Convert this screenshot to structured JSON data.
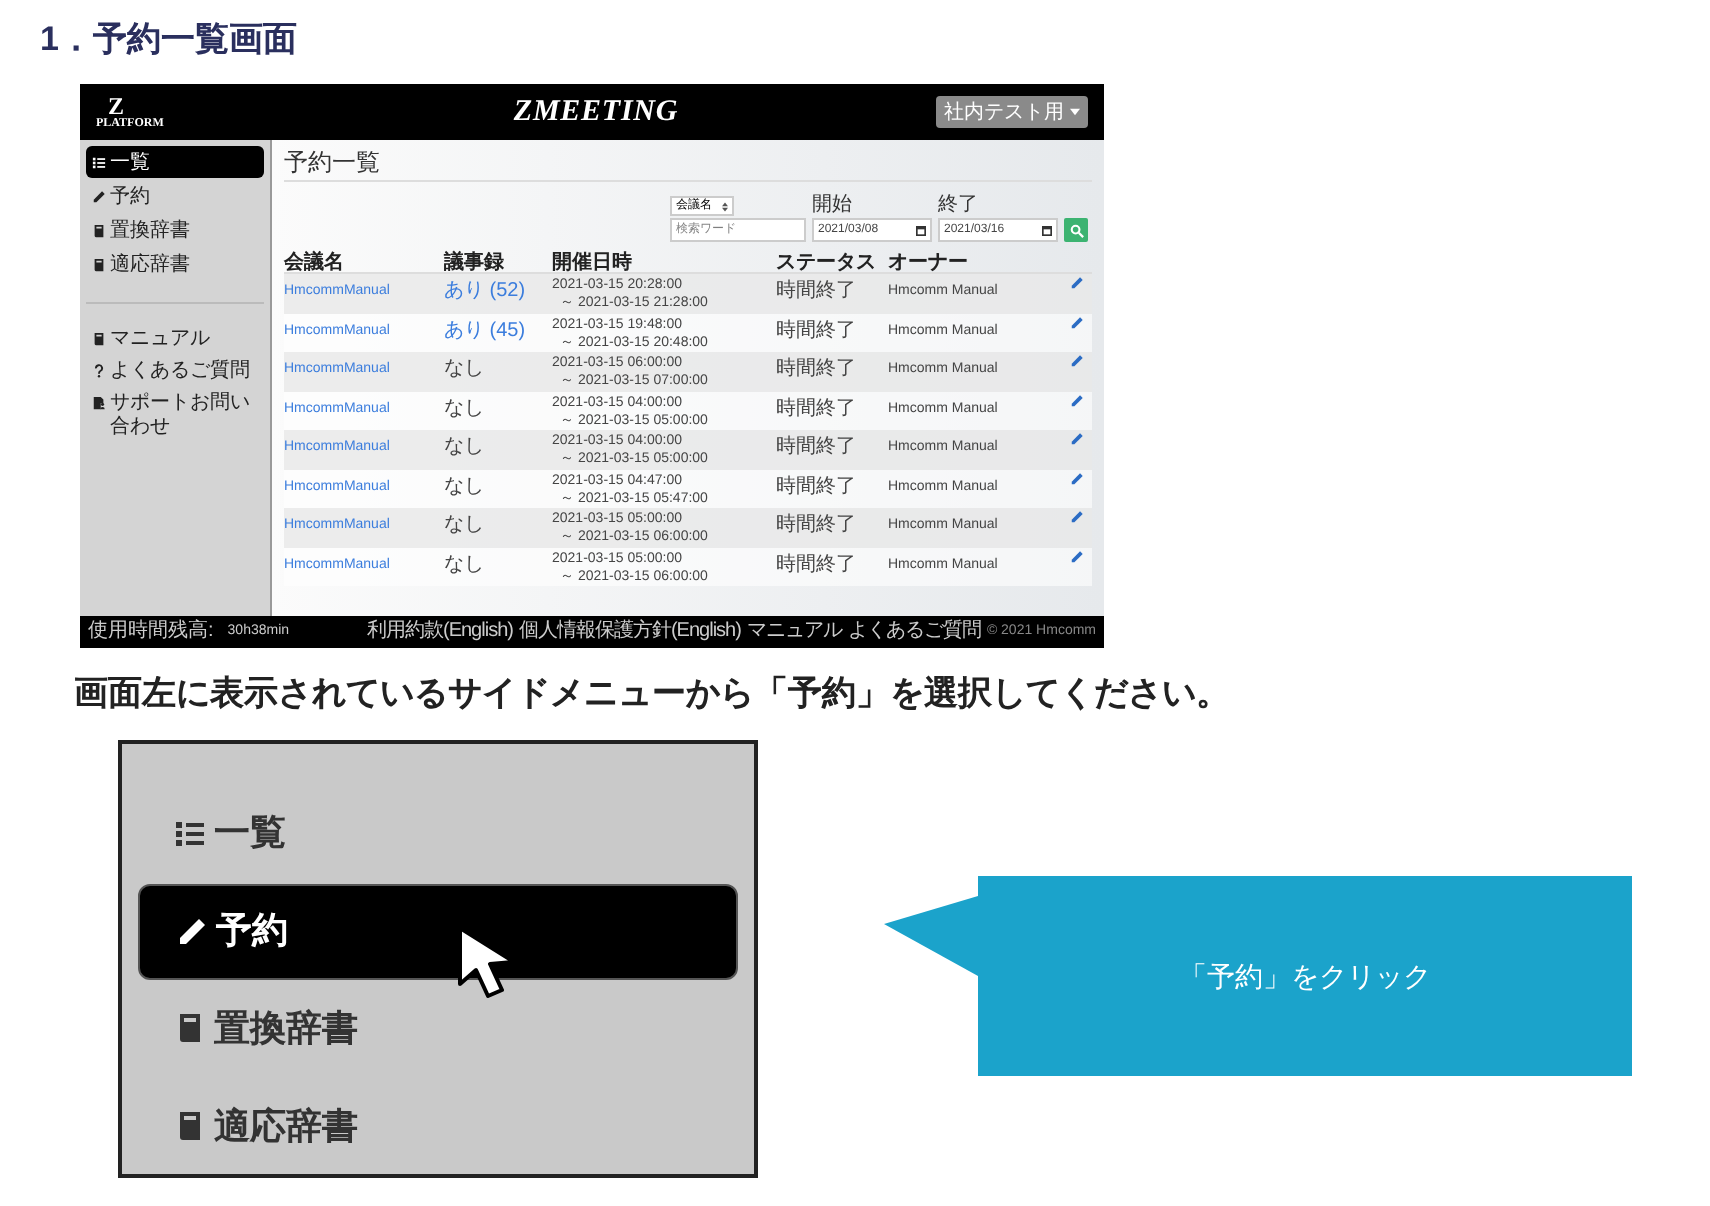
{
  "heading": "1．予約一覧画面",
  "screenshot": {
    "logo": {
      "letter": "Z",
      "text": "PLATFORM"
    },
    "app_title": "ZMEETING",
    "user_menu": "社内テスト用",
    "sidebar": {
      "items": [
        {
          "label": "一覧",
          "kind": "list",
          "selected": true
        },
        {
          "label": "予約",
          "kind": "pencil",
          "selected": false
        },
        {
          "label": "置換辞書",
          "kind": "book",
          "selected": false
        },
        {
          "label": "適応辞書",
          "kind": "book",
          "selected": false
        }
      ],
      "bottom_items": [
        {
          "label": "マニュアル",
          "kind": "book"
        },
        {
          "label": "よくあるご質問",
          "kind": "question"
        },
        {
          "label": "サポートお問い合わせ",
          "kind": "support"
        }
      ]
    },
    "page_title": "予約一覧",
    "search": {
      "field_select": "会議名",
      "keyword_placeholder": "検索ワード",
      "start_label": "開始",
      "start_date": "2021/03/08",
      "end_label": "終了",
      "end_date": "2021/03/16"
    },
    "table": {
      "columns": [
        "会議名",
        "議事録",
        "開催日時",
        "ステータス",
        "オーナー"
      ],
      "rows": [
        {
          "name": "HmcommManual",
          "minutes": "あり (52)",
          "kind": "link",
          "start": "2021-03-15 20:28:00",
          "end": "～ 2021-03-15 21:28:00",
          "status": "時間終了",
          "owner": "Hmcomm Manual"
        },
        {
          "name": "HmcommManual",
          "minutes": "あり (45)",
          "kind": "link",
          "start": "2021-03-15 19:48:00",
          "end": "～ 2021-03-15 20:48:00",
          "status": "時間終了",
          "owner": "Hmcomm Manual"
        },
        {
          "name": "HmcommManual",
          "minutes": "なし",
          "kind": "plain",
          "start": "2021-03-15 06:00:00",
          "end": "～ 2021-03-15 07:00:00",
          "status": "時間終了",
          "owner": "Hmcomm Manual"
        },
        {
          "name": "HmcommManual",
          "minutes": "なし",
          "kind": "plain",
          "start": "2021-03-15 04:00:00",
          "end": "～ 2021-03-15 05:00:00",
          "status": "時間終了",
          "owner": "Hmcomm Manual"
        },
        {
          "name": "HmcommManual",
          "minutes": "なし",
          "kind": "plain",
          "start": "2021-03-15 04:00:00",
          "end": "～ 2021-03-15 05:00:00",
          "status": "時間終了",
          "owner": "Hmcomm Manual"
        },
        {
          "name": "HmcommManual",
          "minutes": "なし",
          "kind": "plain",
          "start": "2021-03-15 04:47:00",
          "end": "～ 2021-03-15 05:47:00",
          "status": "時間終了",
          "owner": "Hmcomm Manual"
        },
        {
          "name": "HmcommManual",
          "minutes": "なし",
          "kind": "plain",
          "start": "2021-03-15 05:00:00",
          "end": "～ 2021-03-15 06:00:00",
          "status": "時間終了",
          "owner": "Hmcomm Manual"
        },
        {
          "name": "HmcommManual",
          "minutes": "なし",
          "kind": "plain",
          "start": "2021-03-15 05:00:00",
          "end": "～ 2021-03-15 06:00:00",
          "status": "時間終了",
          "owner": "Hmcomm Manual"
        }
      ]
    },
    "footer": {
      "remaining_label": "使用時間残高:",
      "remaining": "30h38min",
      "links": [
        "利用約款(English)",
        "個人情報保護方針(English)",
        "マニュアル",
        "よくあるご質問"
      ],
      "copyright": "© 2021 Hmcomm"
    }
  },
  "instruction": "画面左に表示されているサイドメニューから「予約」を選択してください。",
  "zoomed_sidebar": {
    "items": [
      {
        "label": "一覧",
        "kind": "list",
        "selected": false
      },
      {
        "label": "予約",
        "kind": "pencil",
        "selected": true
      },
      {
        "label": "置換辞書",
        "kind": "book",
        "selected": false
      },
      {
        "label": "適応辞書",
        "kind": "book",
        "selected": false
      }
    ]
  },
  "callout": {
    "text": "「予約」をクリック"
  }
}
